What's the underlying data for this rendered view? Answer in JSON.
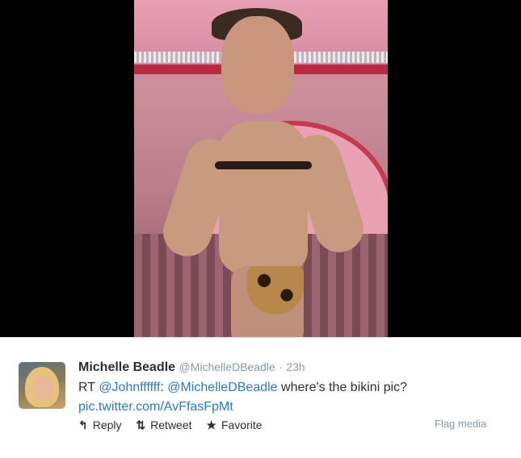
{
  "tweet": {
    "fullname": "Michelle Beadle",
    "username": "@MichelleDBeadle",
    "separator": "·",
    "time": "23h",
    "text_prefix": "RT ",
    "mention_1": "@Johnffffff",
    "colon": ": ",
    "mention_2": "@MichelleDBeadle",
    "text_body": " where's the bikini pic?",
    "link": "pic.twitter.com/AvFfasFpMt"
  },
  "actions": {
    "reply_label": "Reply",
    "reply_icon": "reply-icon",
    "retweet_label": "Retweet",
    "retweet_icon": "retweet-icon",
    "favorite_label": "Favorite",
    "favorite_icon": "star-icon",
    "flag_label": "Flag media"
  },
  "colors": {
    "link": "#2b7bb9",
    "muted": "#8899a6",
    "text": "#292f33"
  }
}
